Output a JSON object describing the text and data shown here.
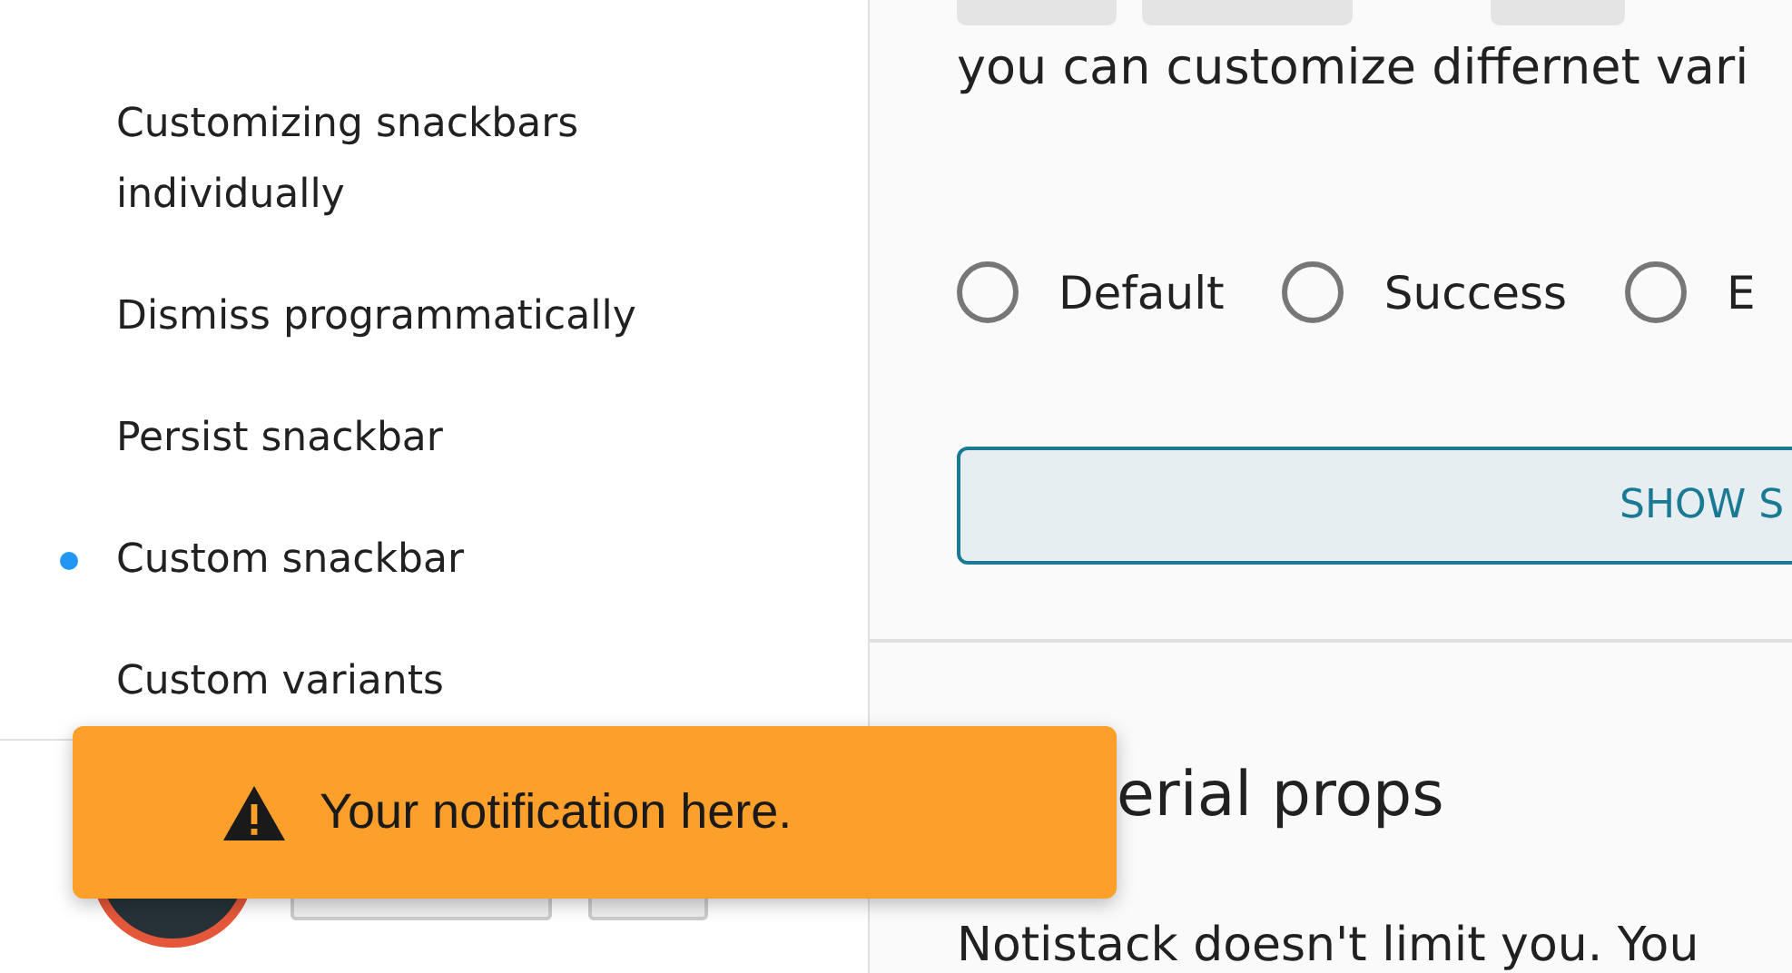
{
  "sidebar": {
    "items": [
      {
        "label": "Customizing snackbars individually",
        "selected": false
      },
      {
        "label": "Dismiss programmatically",
        "selected": false
      },
      {
        "label": "Persist snackbar",
        "selected": false
      },
      {
        "label": "Custom snackbar",
        "selected": true
      },
      {
        "label": "Custom variants",
        "selected": false
      }
    ]
  },
  "content": {
    "intro": "you can customize differnet vari",
    "variants": [
      {
        "label": "Default",
        "selected": false
      },
      {
        "label": "Success",
        "selected": false
      },
      {
        "label": "E",
        "selected": false
      }
    ],
    "button": "SHOW S",
    "heading": "erial props",
    "paragraph": "Notistack doesn't limit you. You"
  },
  "snackbar": {
    "message": "Your notification here."
  }
}
